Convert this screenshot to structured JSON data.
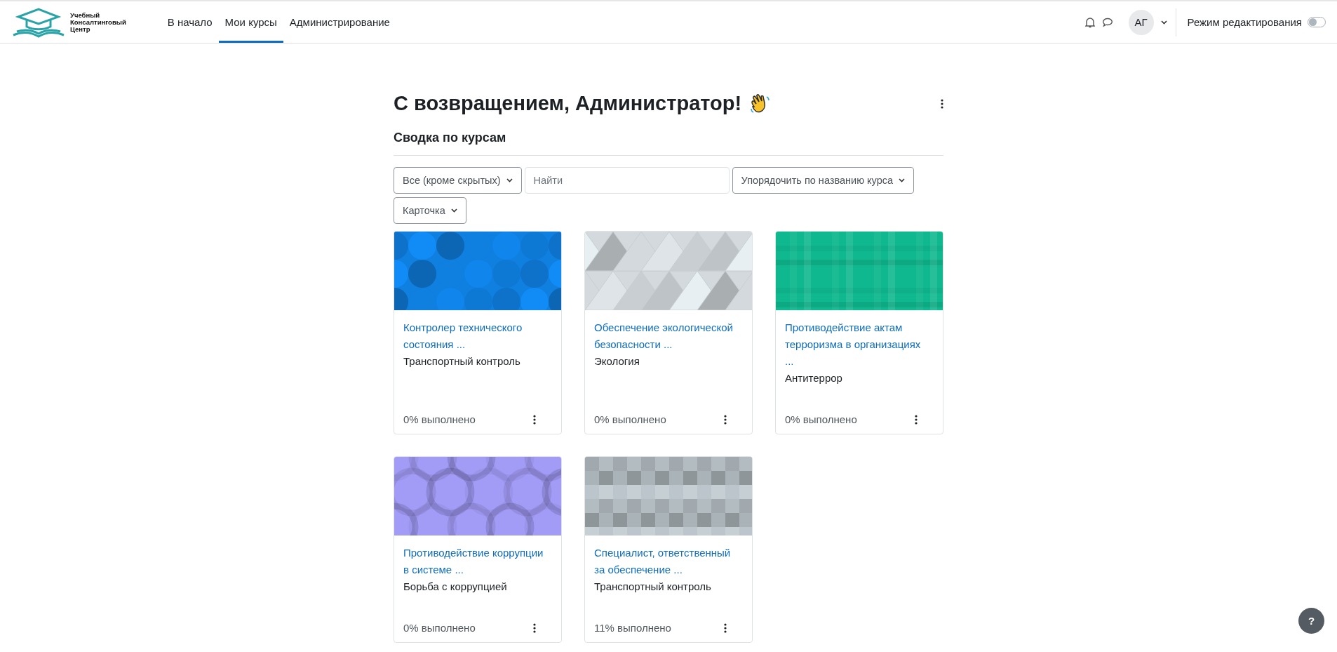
{
  "logo": {
    "lines": [
      "Учебный",
      "Консалтинговый",
      "Центр"
    ]
  },
  "nav": [
    {
      "label": "В начало",
      "selected": false
    },
    {
      "label": "Мои курсы",
      "selected": true
    },
    {
      "label": "Администрирование",
      "selected": false
    }
  ],
  "user": {
    "initials": "АГ"
  },
  "edit_mode": {
    "label": "Режим редактирования",
    "on": false
  },
  "heading": "С возвращением, Администратор!",
  "section_title": "Сводка по курсам",
  "filters": [
    {
      "kind": "select",
      "label": "Все (кроме скрытых)"
    },
    {
      "kind": "search",
      "placeholder": "Найти"
    },
    {
      "kind": "select",
      "label": "Упорядочить по названию курса"
    },
    {
      "kind": "select",
      "label": "Карточка"
    }
  ],
  "courses": [
    {
      "title": "Контролер технического состояния ...",
      "category": "Транспортный контроль",
      "progress": "0% выполнено",
      "kind": "octagons",
      "color": "#0f7fe0"
    },
    {
      "title": "Обеспечение экологической безопасности ...",
      "category": "Экология",
      "progress": "0% выполнено",
      "kind": "triangles",
      "color": "#d3d9dd"
    },
    {
      "title": "Противодействие актам терроризма в организациях ...",
      "category": "Антитеррор",
      "progress": "0% выполнено",
      "kind": "plaid",
      "color": "#0fb88f"
    },
    {
      "title": "Противодействие коррупции в системе ...",
      "category": "Борьба с коррупцией",
      "progress": "0% выполнено",
      "kind": "circles",
      "color": "#a39cf7"
    },
    {
      "title": "Специалист, ответственный за обеспечение ...",
      "category": "Транспортный контроль",
      "progress": "11% выполнено",
      "kind": "squares",
      "color": "#b3bcc1"
    }
  ],
  "help": {
    "label": "?"
  }
}
